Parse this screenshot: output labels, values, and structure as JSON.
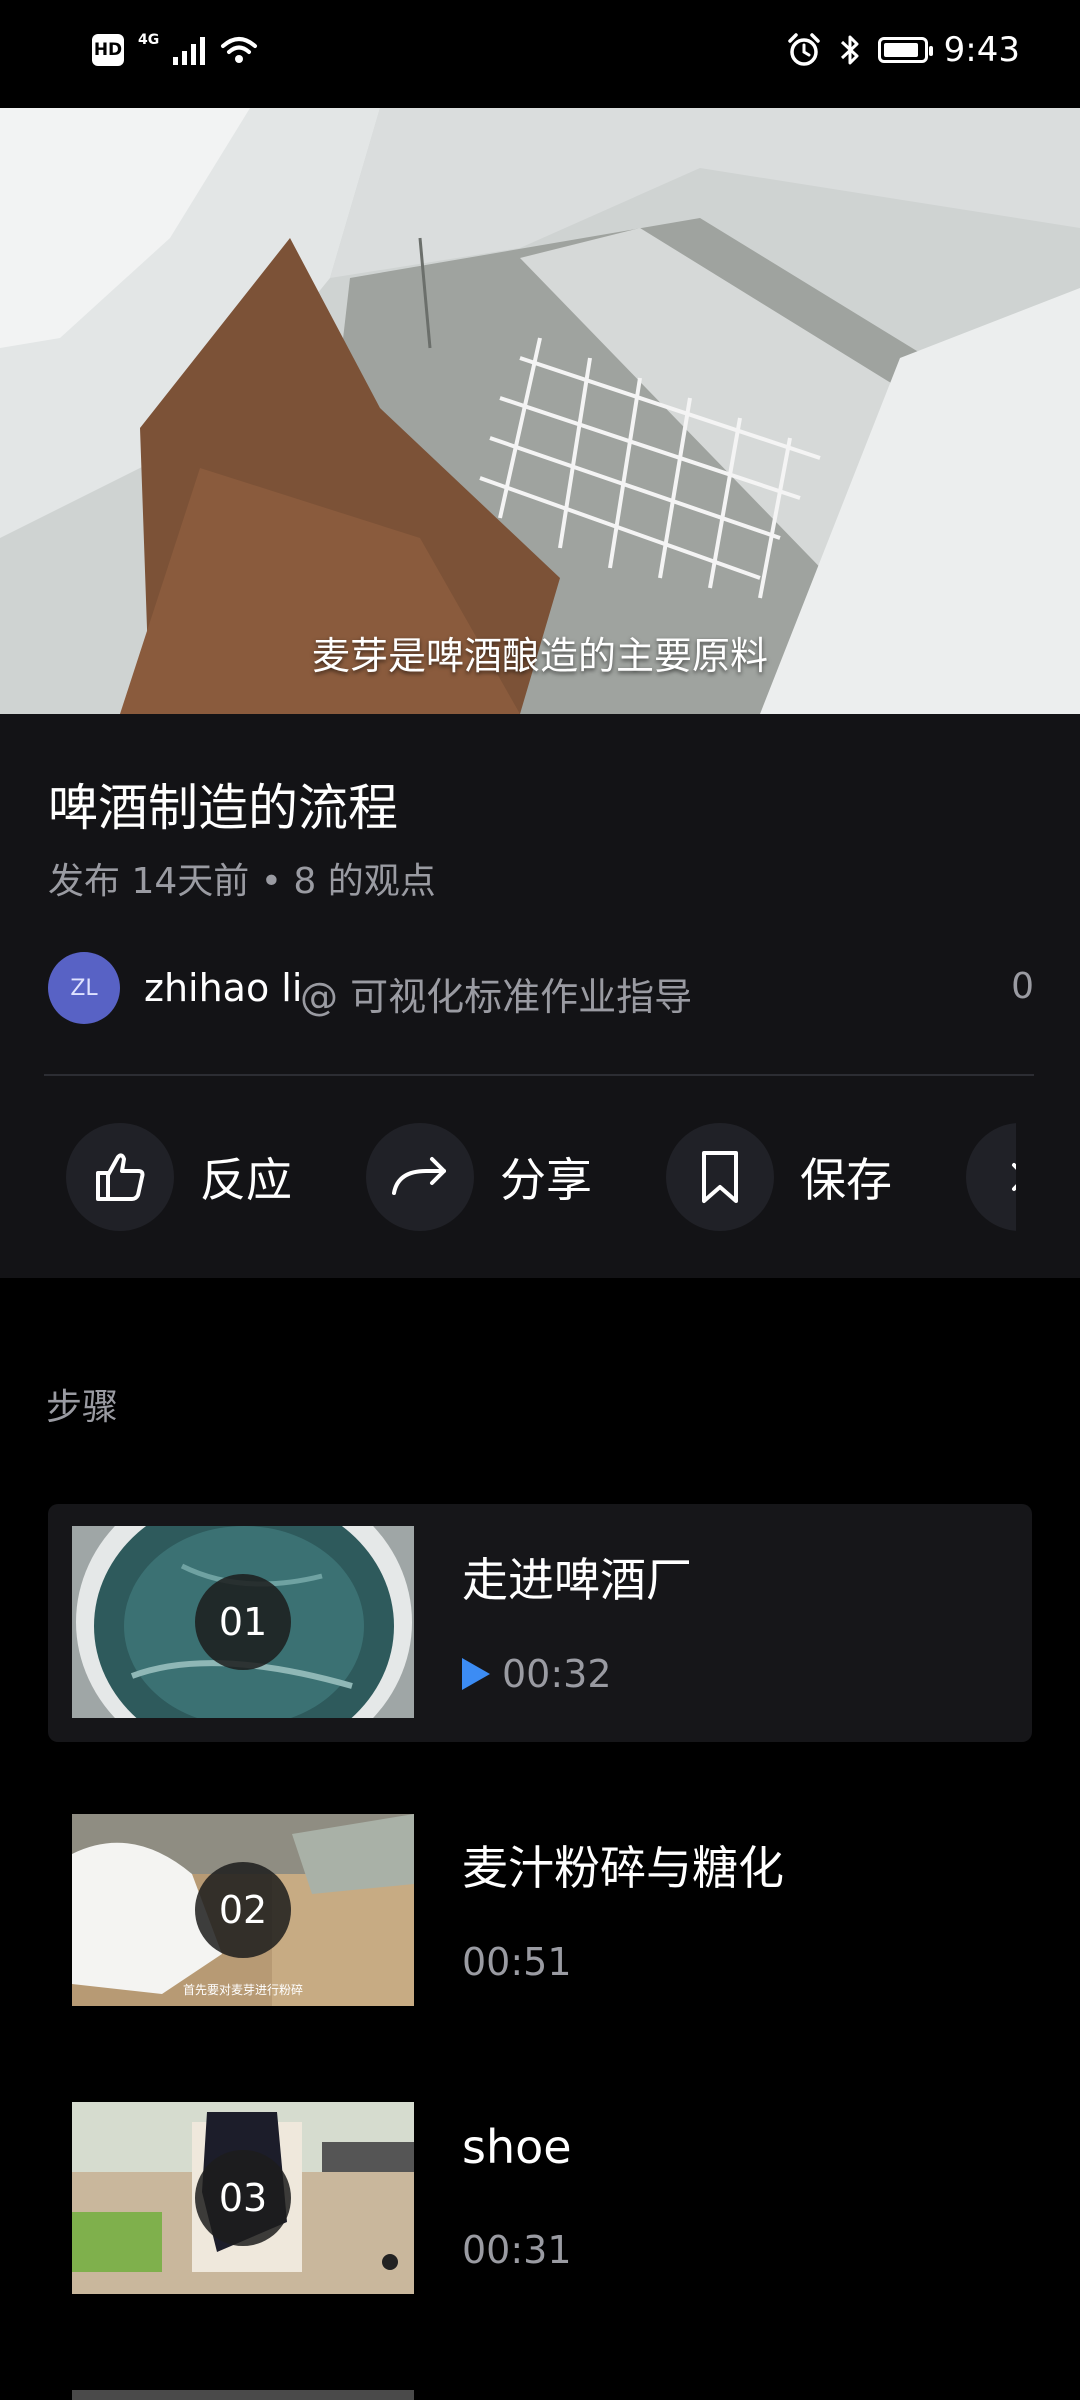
{
  "status_bar": {
    "hd": "HD",
    "network": "4G",
    "time": "9:43",
    "battery_level_percent": 90
  },
  "video": {
    "caption": "麦芽是啤酒酿造的主要原料"
  },
  "info": {
    "title": "啤酒制造的流程",
    "meta": "发布 14天前 • 8 的观点",
    "author": {
      "initials": "ZL",
      "name": "zhihao li",
      "org": "@ 可视化标准作业指导",
      "count": "0"
    }
  },
  "actions": {
    "react": "反应",
    "share": "分享",
    "save": "保存"
  },
  "steps": {
    "header": "步骤",
    "items": [
      {
        "number": "01",
        "title": "走进啤酒厂",
        "duration": "00:32",
        "thumb_caption": ""
      },
      {
        "number": "02",
        "title": "麦汁粉碎与糖化",
        "duration": "00:51",
        "thumb_caption": "首先要对麦芽进行粉碎"
      },
      {
        "number": "03",
        "title": "shoe",
        "duration": "00:31",
        "thumb_caption": ""
      }
    ]
  },
  "colors": {
    "accent": "#3c8cf4",
    "panel": "#131316",
    "avatar": "#5862c5"
  }
}
